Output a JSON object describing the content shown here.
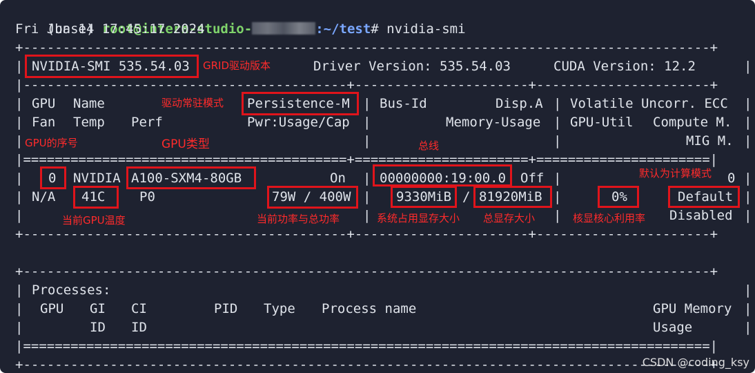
{
  "prompt": {
    "env": "(base) ",
    "user": "root@intern-studio-",
    "sep": ":",
    "path": "~/test",
    "symbol": "# ",
    "command": "nvidia-smi"
  },
  "date": "Fri Jun 14 17:45:17 2024",
  "lines": {
    "border_top": "+---------------------------------------------------------------------------------------+",
    "smi_version": "NVIDIA-SMI 535.54.03",
    "driver_version": "Driver Version: 535.54.03",
    "cuda_version": "CUDA Version: 12.2",
    "sep_dashes": "|-----------------------------------------+----------------------+----------------------+",
    "hdr1_gpu": "GPU",
    "hdr1_name": "Name",
    "hdr1_persistence": "Persistence-M",
    "hdr1_busid": "Bus-Id",
    "hdr1_disp": "Disp.A",
    "hdr1_volatile": "Volatile Uncorr. ECC",
    "hdr2_fan": "Fan",
    "hdr2_temp": "Temp",
    "hdr2_perf": "Perf",
    "hdr2_pwr": "Pwr:Usage/Cap",
    "hdr2_memusage": "Memory-Usage",
    "hdr2_gpuutil": "GPU-Util",
    "hdr2_compute": "Compute M.",
    "hdr3_mig": "MIG M.",
    "sep_equals": "|=========================================+======================+======================|",
    "gpu_index": "0",
    "gpu_vendor": "NVIDIA",
    "gpu_model": "A100-SXM4-80GB",
    "persistence": "On",
    "bus_id": "00000000:19:00.0",
    "disp": "Off",
    "ecc": "0",
    "fan": "N/A",
    "temp": "41C",
    "perf": "P0",
    "power": "79W / 400W",
    "mem_used": "9330MiB",
    "mem_slash": "/",
    "mem_total": "81920MiB",
    "util": "0%",
    "compute_mode": "Default",
    "mig_mode": "Disabled",
    "border_mid": "+-----------------------------------------+----------------------+----------------------+",
    "proc_title": "Processes:",
    "proc_gpu": "GPU",
    "proc_gi": "GI",
    "proc_ci": "CI",
    "proc_pid": "PID",
    "proc_type": "Type",
    "proc_name": "Process name",
    "proc_mem": "GPU Memory",
    "proc_gi2": "ID",
    "proc_ci2": "ID",
    "proc_mem2": "Usage",
    "proc_equals": "|=======================================================================================|",
    "border_bottom": "+---------------------------------------------------------------------------------------+"
  },
  "annotations": {
    "grid_driver": "GRID驱动版本",
    "persistence_mode": "驱动常驻模式",
    "gpu_index": "GPU的序号",
    "gpu_type": "GPU类型",
    "bus": "总线",
    "default_compute": "默认为计算模式",
    "gpu_temp": "当前GPU温度",
    "power": "当前功率与总功率",
    "mem_used": "系统占用显存大小",
    "mem_total": "总显存大小",
    "util": "核显核心利用率"
  },
  "watermark": "CSDN @coding_ksy",
  "colors": {
    "terminal_bg": "#1e2230",
    "text": "#dfe3ea",
    "user": "#7fd36b",
    "path": "#7aa7ff",
    "annotation": "#e0141b"
  }
}
